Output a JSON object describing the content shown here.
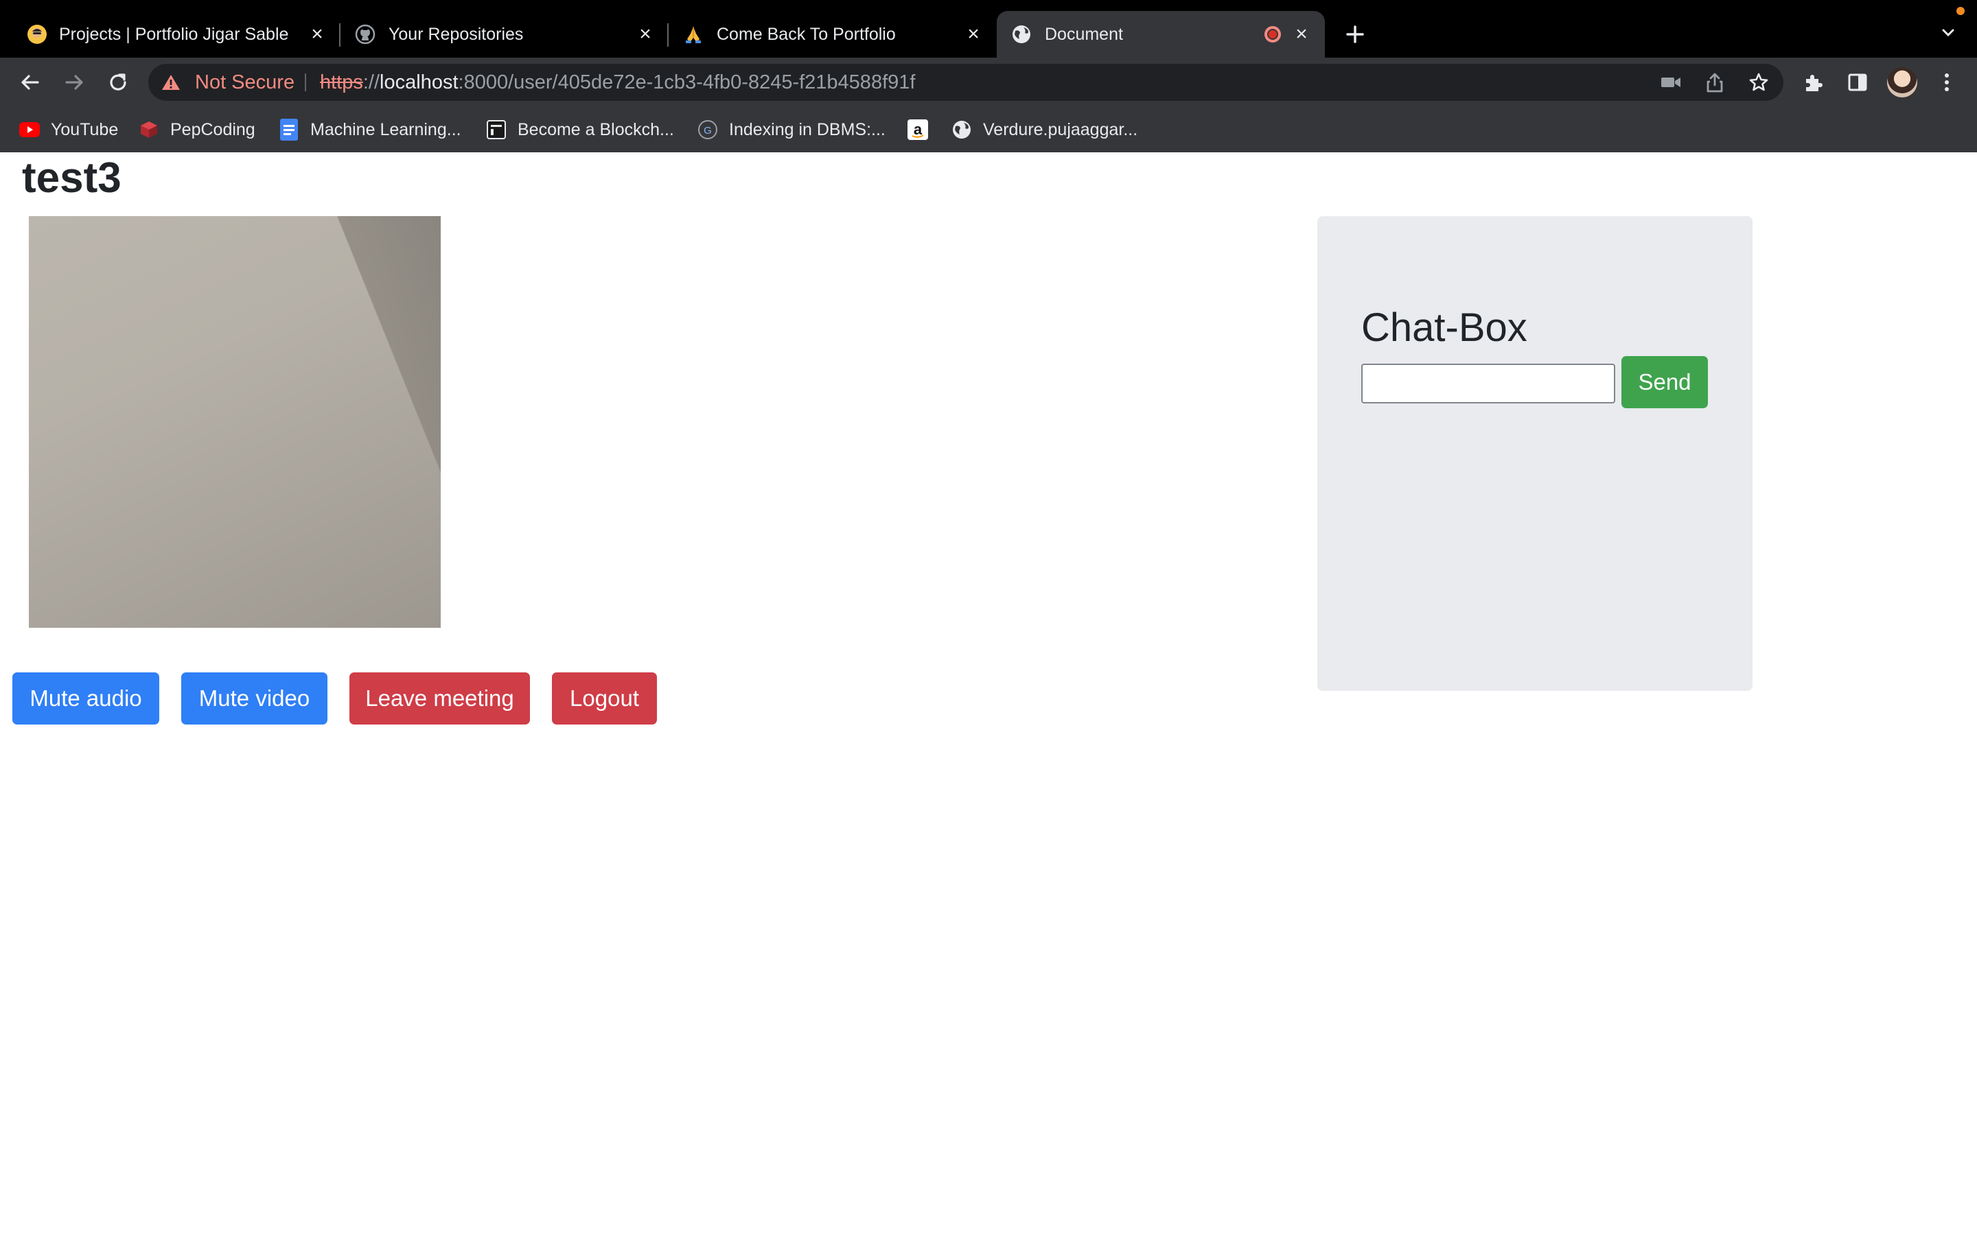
{
  "browser": {
    "tabs": [
      {
        "title": "Projects | Portfolio Jigar Sable",
        "favicon": "avatar-emoji-icon",
        "active": false
      },
      {
        "title": "Your Repositories",
        "favicon": "github-icon",
        "active": false
      },
      {
        "title": "Come Back To Portfolio",
        "favicon": "folded-hands-icon",
        "active": false
      },
      {
        "title": "Document",
        "favicon": "globe-icon",
        "active": true,
        "recording": true
      }
    ],
    "address_bar": {
      "security_label": "Not Secure",
      "scheme": "https",
      "separator": "://",
      "host": "localhost",
      "path": ":8000/user/405de72e-1cb3-4fb0-8245-f21b4588f91f"
    },
    "bookmarks": [
      {
        "label": "YouTube",
        "icon": "youtube-icon"
      },
      {
        "label": "PepCoding",
        "icon": "pepcoding-icon"
      },
      {
        "label": "Machine Learning...",
        "icon": "google-docs-icon"
      },
      {
        "label": "Become a Blockch...",
        "icon": "blockchain-icon"
      },
      {
        "label": "Indexing in DBMS:...",
        "icon": "gfg-icon"
      },
      {
        "label": "",
        "icon": "amazon-icon"
      },
      {
        "label": "Verdure.pujaaggar...",
        "icon": "globe-icon"
      }
    ],
    "colors": {
      "chrome_bg": "#35363a",
      "tabstrip_bg": "#000000",
      "warning": "#f28b82"
    }
  },
  "page": {
    "title": "test3",
    "controls": {
      "mute_audio": "Mute audio",
      "mute_video": "Mute video",
      "leave_meeting": "Leave meeting",
      "logout": "Logout"
    },
    "chat": {
      "title": "Chat-Box",
      "input_value": "",
      "send_label": "Send"
    },
    "colors": {
      "primary": "#2f7ff6",
      "danger": "#cf3d47",
      "success": "#3fa34d",
      "panel": "#e9ebee"
    }
  }
}
